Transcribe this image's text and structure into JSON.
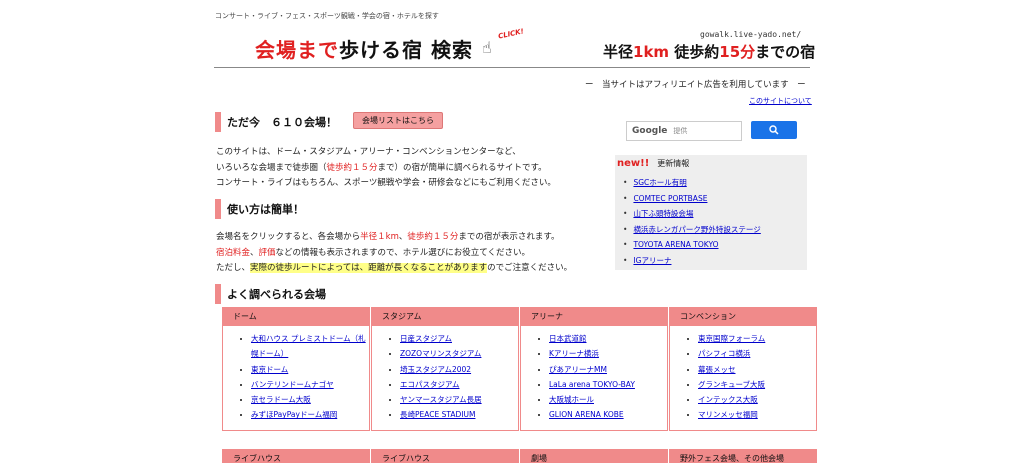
{
  "header": {
    "tagline": "コンサート・ライブ・フェス・スポーツ観戦・学会の宿・ホテルを探す",
    "logo_red": "会場まで",
    "logo_black": "歩ける宿 検索",
    "click": "CLICK!",
    "url": "gowalk.live-yado.net/",
    "slogan_pre": "半径",
    "slogan_num1": "1km",
    "slogan_mid": " 徒歩約",
    "slogan_num2": "15分",
    "slogan_post": "までの宿"
  },
  "affiliate": "ー　当サイトはアフィリエイト広告を利用しています　ー",
  "about_link": "このサイトについて",
  "intro": {
    "title": "ただ今　６１０会場！",
    "venue_button": "会場リストはこちら",
    "line1": "このサイトは、ドーム・スタジアム・アリーナ・コンベンションセンターなど、",
    "line2_a": "いろいろな会場まで徒歩圏（",
    "line2_red": "徒歩約１５分",
    "line2_b": "まで）の宿が簡単に調べられるサイトです。",
    "line3": "コンサート・ライブはもちろん、スポーツ観戦や学会・研修会などにもご利用ください。"
  },
  "howto": {
    "title": "使い方は簡単！",
    "l1_a": "会場名をクリックすると、各会場から",
    "l1_red1": "半径１km",
    "l1_b": "、",
    "l1_red2": "徒歩約１５分",
    "l1_c": "までの宿が表示されます。",
    "l2_red1": "宿泊料金",
    "l2_a": "、",
    "l2_red2": "評価",
    "l2_b": "などの情報も表示されますので、ホテル選びにお役立てください。",
    "l3_a": "ただし、",
    "l3_hl": "実際の徒歩ルートによっては、距離が長くなることがあります",
    "l3_b": "のでご注意ください。"
  },
  "popular_title": "よく調べられる会場",
  "search": {
    "google": "Google",
    "placeholder": "提供"
  },
  "news": {
    "badge": "new!!",
    "title": "更新情報",
    "items": [
      "SGCホール有明",
      "COMTEC PORTBASE",
      "山下ふ頭特設会場",
      "横浜赤レンガパーク野外特設ステージ",
      "TOYOTA ARENA TOKYO",
      "IGアリーナ"
    ]
  },
  "categories": [
    {
      "title": "ドーム",
      "items": [
        "大和ハウス プレミストドーム（札幌ドーム）",
        "東京ドーム",
        "バンテリンドームナゴヤ",
        "京セラドーム大阪",
        "みずほPayPayドーム福岡"
      ]
    },
    {
      "title": "スタジアム",
      "items": [
        "日産スタジアム",
        "ZOZOマリンスタジアム",
        "埼玉スタジアム2002",
        "エコパスタジアム",
        "ヤンマースタジアム長居",
        "長崎PEACE STADIUM"
      ]
    },
    {
      "title": "アリーナ",
      "items": [
        "日本武道館",
        "Kアリーナ横浜",
        "ぴあアリーナMM",
        "LaLa arena TOKYO-BAY",
        "大阪城ホール",
        "GLION ARENA KOBE"
      ]
    },
    {
      "title": "コンベンション",
      "items": [
        "東京国際フォーラム",
        "パシフィコ横浜",
        "幕張メッセ",
        "グランキューブ大阪",
        "インテックス大阪",
        "マリンメッセ福岡"
      ]
    }
  ],
  "categories2": [
    "ライブハウス",
    "ライブハウス",
    "劇場",
    "野外フェス会場、その他会場"
  ]
}
